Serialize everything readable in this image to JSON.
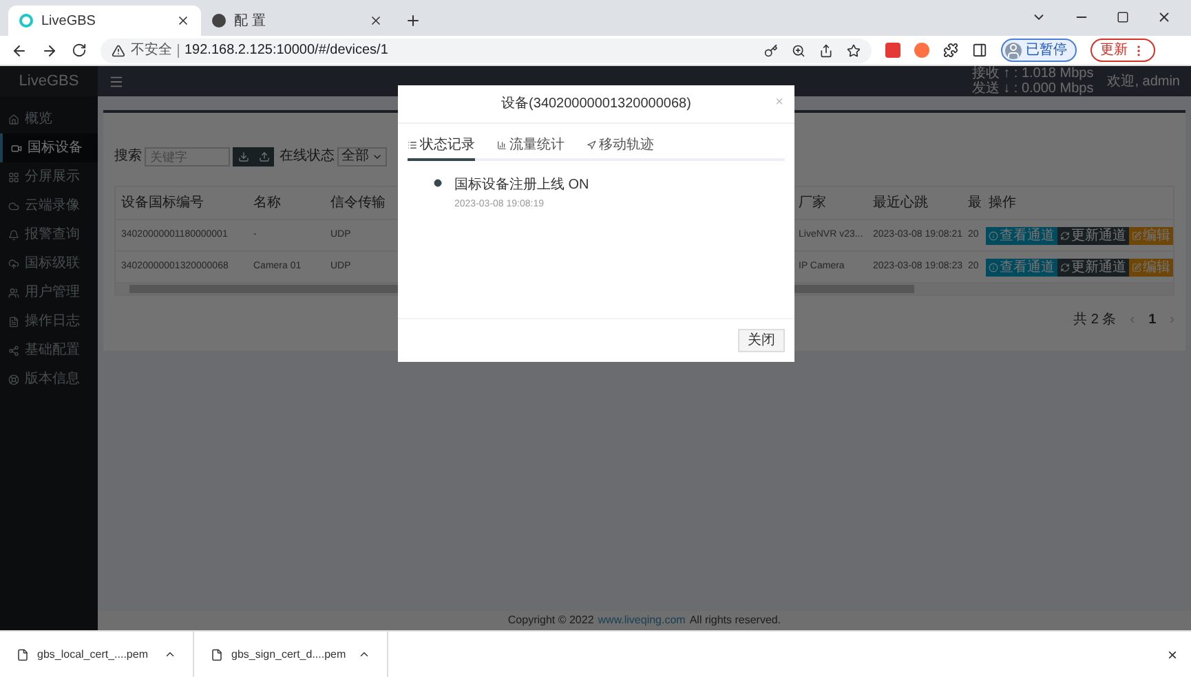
{
  "browser": {
    "tabs": [
      {
        "title": "LiveGBS",
        "selected": true
      },
      {
        "title": "配 置",
        "selected": false
      }
    ],
    "address": {
      "warning": "不安全",
      "url": "192.168.2.125:10000/#/devices/1"
    },
    "profile": "已暂停",
    "update": "更新"
  },
  "app": {
    "logo": "LiveGBS",
    "sidebar": {
      "items": [
        {
          "label": "概览",
          "selected": false
        },
        {
          "label": "国标设备",
          "selected": true
        },
        {
          "label": "分屏展示",
          "selected": false
        },
        {
          "label": "云端录像",
          "selected": false
        },
        {
          "label": "报警查询",
          "selected": false
        },
        {
          "label": "国标级联",
          "selected": false
        },
        {
          "label": "用户管理",
          "selected": false
        },
        {
          "label": "操作日志",
          "selected": false
        },
        {
          "label": "基础配置",
          "selected": false
        },
        {
          "label": "版本信息",
          "selected": false
        }
      ]
    },
    "header": {
      "receive": "接收 ↑ : 1.018 Mbps",
      "send": "发送 ↓ : 0.000 Mbps",
      "welcome": "欢迎, admin"
    },
    "toolbar": {
      "search_label": "搜索",
      "search": {
        "placeholder": "关键字"
      },
      "status_label": "在线状态",
      "status_value": "全部"
    },
    "table": {
      "columns": [
        "设备国标编号",
        "名称",
        "信令传输",
        "厂家",
        "最近心跳",
        "最",
        "操作"
      ],
      "rows": [
        {
          "cells": [
            "34020000001180000001",
            "-",
            "UDP",
            "LiveNVR v23...",
            "2023-03-08 19:08:21",
            "20"
          ],
          "actions": [
            "查看通道",
            "更新通道",
            "编辑"
          ]
        },
        {
          "cells": [
            "34020000001320000068",
            "Camera 01",
            "UDP",
            "IP Camera",
            "2023-03-08 19:08:23",
            "20"
          ],
          "actions": [
            "查看通道",
            "更新通道",
            "编辑"
          ]
        }
      ]
    },
    "pagination": {
      "total": "共 2 条",
      "prev": "‹",
      "page": "1",
      "next": "›"
    },
    "footer": {
      "before": "Copyright © 2022",
      "link": "www.liveqing.com",
      "after": "All rights reserved."
    }
  },
  "dialog": {
    "title": "设备(34020000001320000068)",
    "close": "×",
    "tabs": [
      {
        "label": "状态记录",
        "selected": true
      },
      {
        "label": "流量统计",
        "selected": false
      },
      {
        "label": "移动轨迹",
        "selected": false
      }
    ],
    "events": [
      {
        "text": "国标设备注册上线 ON",
        "time": "2023-03-08 19:08:19"
      }
    ],
    "button": "关闭"
  },
  "downloads": {
    "files": [
      "gbs_local_cert_....pem",
      "gbs_sign_cert_d....pem"
    ],
    "close": "×"
  }
}
